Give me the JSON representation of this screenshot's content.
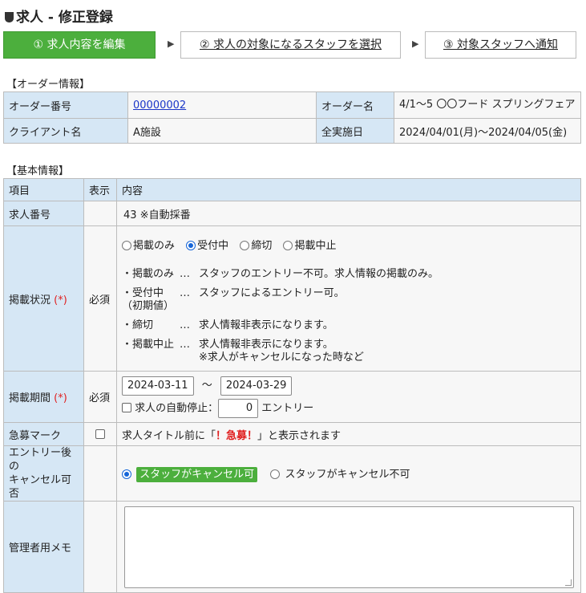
{
  "page_title": "求人 - 修正登録",
  "steps": {
    "step1": "① 求人内容を編集",
    "step2": "② 求人の対象になるスタッフを選択",
    "step3": "③ 対象スタッフへ通知",
    "arrow": "▶"
  },
  "order_section": {
    "label": "【オーダー情報】",
    "order_no_label": "オーダー番号",
    "order_no": "00000002",
    "order_name_label": "オーダー名",
    "order_name": "4/1～5 〇〇フード スプリングフェア",
    "client_label": "クライアント名",
    "client": "A施設",
    "dates_label": "全実施日",
    "dates": "2024/04/01(月)～2024/04/05(金)"
  },
  "basic_section": {
    "label": "【基本情報】",
    "headers": {
      "item": "項目",
      "display": "表示",
      "content": "内容"
    },
    "job_no": {
      "label": "求人番号",
      "value": "43 ※自動採番"
    },
    "status": {
      "label": "掲載状況",
      "req_mark": "(*)",
      "required": "必須",
      "options": [
        "掲載のみ",
        "受付中",
        "締切",
        "掲載中止"
      ],
      "selected": "受付中",
      "descriptions": [
        {
          "key": "・掲載のみ",
          "dots": "…",
          "text": "スタッフのエントリー不可。求人情報の掲載のみ。"
        },
        {
          "key": "・受付中",
          "key2": "（初期値）",
          "dots": "…",
          "text": "スタッフによるエントリー可。"
        },
        {
          "key": "・締切",
          "dots": "…",
          "text": "求人情報非表示になります。"
        },
        {
          "key": "・掲載中止",
          "dots": "…",
          "text": "求人情報非表示になります。",
          "text2": "※求人がキャンセルになった時など"
        }
      ]
    },
    "period": {
      "label": "掲載期間",
      "req_mark": "(*)",
      "required": "必須",
      "start": "2024-03-11",
      "sep": "～",
      "end": "2024-03-29",
      "auto_stop_label": "求人の自動停止：",
      "auto_stop_value": "0",
      "auto_stop_unit": "エントリー"
    },
    "urgent": {
      "label": "急募マーク",
      "text_pre": "求人タイトル前に「",
      "badge": "！急募！",
      "text_post": "」と表示されます"
    },
    "cancel": {
      "label_line1": "エントリー後の",
      "label_line2": "キャンセル可否",
      "option_yes": "スタッフがキャンセル可",
      "option_no": "スタッフがキャンセル不可"
    },
    "memo": {
      "label": "管理者用メモ",
      "value": ""
    }
  }
}
